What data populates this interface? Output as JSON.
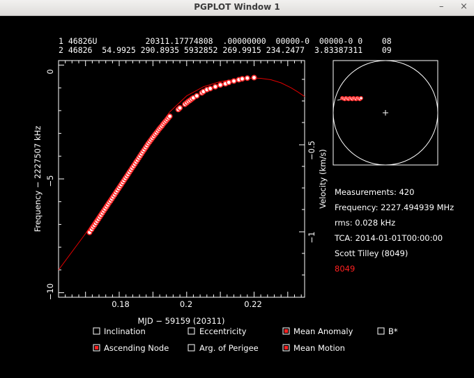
{
  "window": {
    "title": "PGPLOT Window 1",
    "minimize_icon": "–",
    "close_icon": "×"
  },
  "tle": {
    "line1": "1 46826U          20311.17774808  .00000000  00000-0  00000-0 0    08",
    "line2": "2 46826  54.9925 290.8935 5932852 269.9915 234.2477  3.83387311    09"
  },
  "axes": {
    "ylabel_left": "Frequency − 2227507 kHz",
    "ylabel_right": "Velocity (km/s)",
    "xlabel": "MJD − 59159 (20311)",
    "xticks": [
      "0.18",
      "0.2",
      "0.22"
    ],
    "yticks_left": [
      "0",
      "−5",
      "−10"
    ],
    "yticks_right": [
      "−0.5",
      "−1"
    ]
  },
  "info": {
    "measurements": "Measurements: 420",
    "frequency": "Frequency: 2227.494939 MHz",
    "rms": "rms: 0.028 kHz",
    "tca": "TCA: 2014-01-01T00:00:00",
    "observer": "Scott Tilley (8049)",
    "site": "8049"
  },
  "checkboxes": [
    {
      "label": "Inclination",
      "checked": false
    },
    {
      "label": "Eccentricity",
      "checked": false
    },
    {
      "label": "Mean Anomaly",
      "checked": true
    },
    {
      "label": "B*",
      "checked": false
    },
    {
      "label": "Ascending Node",
      "checked": true
    },
    {
      "label": "Arg. of Perigee",
      "checked": false
    },
    {
      "label": "Mean Motion",
      "checked": true
    }
  ],
  "colors": {
    "background": "#000000",
    "foreground": "#ffffff",
    "model": "#e00000",
    "points": "#ff2a2a"
  },
  "chart_data": {
    "type": "scatter",
    "xlabel": "MJD − 59159 (20311)",
    "ylabel": "Frequency − 2227507 kHz",
    "xlim": [
      0.162,
      0.235
    ],
    "ylim": [
      -10.2,
      0.2
    ],
    "model_curve": {
      "x": [
        0.162,
        0.165,
        0.17,
        0.175,
        0.18,
        0.185,
        0.19,
        0.195,
        0.2,
        0.205,
        0.21,
        0.215,
        0.218,
        0.22,
        0.222,
        0.225,
        0.228,
        0.231,
        0.233,
        0.235
      ],
      "y": [
        -9.0,
        -8.4,
        -7.4,
        -6.3,
        -5.2,
        -4.1,
        -3.05,
        -2.05,
        -1.35,
        -0.95,
        -0.72,
        -0.61,
        -0.58,
        -0.57,
        -0.58,
        -0.64,
        -0.78,
        -1.0,
        -1.18,
        -1.38
      ]
    },
    "measurements": {
      "x": [
        0.1712,
        0.1718,
        0.1722,
        0.1726,
        0.173,
        0.1734,
        0.1738,
        0.1742,
        0.1746,
        0.175,
        0.1754,
        0.1758,
        0.1762,
        0.1766,
        0.177,
        0.1774,
        0.1778,
        0.1782,
        0.1786,
        0.179,
        0.1794,
        0.1798,
        0.1802,
        0.1806,
        0.181,
        0.1814,
        0.1818,
        0.1822,
        0.1826,
        0.183,
        0.1834,
        0.1838,
        0.1842,
        0.1846,
        0.185,
        0.1854,
        0.1858,
        0.1862,
        0.1866,
        0.187,
        0.1874,
        0.1878,
        0.1882,
        0.1886,
        0.189,
        0.1894,
        0.1898,
        0.1902,
        0.1906,
        0.191,
        0.1914,
        0.1918,
        0.1922,
        0.1926,
        0.193,
        0.1934,
        0.1938,
        0.1942,
        0.1946,
        0.195,
        0.1975,
        0.198,
        0.1995,
        0.2,
        0.2005,
        0.201,
        0.2015,
        0.202,
        0.203,
        0.2045,
        0.205,
        0.206,
        0.207,
        0.2085,
        0.21,
        0.2115,
        0.2125,
        0.214,
        0.2155,
        0.2165,
        0.218,
        0.22
      ],
      "y": [
        -7.35,
        -7.22,
        -7.12,
        -7.04,
        -6.95,
        -6.86,
        -6.77,
        -6.68,
        -6.59,
        -6.5,
        -6.41,
        -6.32,
        -6.23,
        -6.14,
        -6.05,
        -5.97,
        -5.88,
        -5.79,
        -5.7,
        -5.61,
        -5.52,
        -5.43,
        -5.34,
        -5.25,
        -5.16,
        -5.07,
        -4.98,
        -4.89,
        -4.8,
        -4.71,
        -4.62,
        -4.53,
        -4.44,
        -4.35,
        -4.26,
        -4.17,
        -4.08,
        -3.99,
        -3.9,
        -3.81,
        -3.72,
        -3.63,
        -3.54,
        -3.45,
        -3.37,
        -3.29,
        -3.21,
        -3.13,
        -3.05,
        -2.98,
        -2.9,
        -2.82,
        -2.75,
        -2.68,
        -2.6,
        -2.53,
        -2.46,
        -2.39,
        -2.32,
        -2.25,
        -1.95,
        -1.88,
        -1.72,
        -1.66,
        -1.6,
        -1.55,
        -1.49,
        -1.44,
        -1.35,
        -1.22,
        -1.16,
        -1.08,
        -1.03,
        -0.95,
        -0.87,
        -0.82,
        -0.76,
        -0.7,
        -0.64,
        -0.6,
        -0.57,
        -0.55
      ]
    }
  }
}
